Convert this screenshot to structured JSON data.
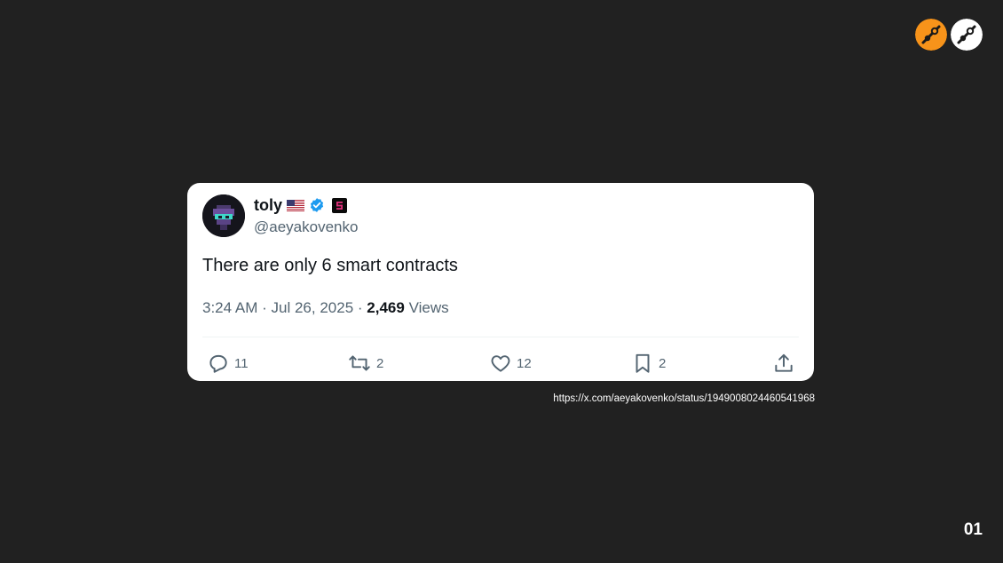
{
  "brand": {
    "accent_color": "#f7931a",
    "logos": [
      {
        "icon": "orange-slash-logo-icon",
        "color": "#f7931a"
      },
      {
        "icon": "white-slash-logo-icon",
        "color": "#ffffff"
      }
    ]
  },
  "tweet": {
    "display_name": "toly",
    "handle": "@aeyakovenko",
    "icons": [
      "us-flag-icon",
      "verified-icon",
      "solana-badge-icon"
    ],
    "text": "There are only 6 smart contracts",
    "time": "3:24 AM",
    "separator": "·",
    "date": "Jul 26, 2025",
    "views_count": "2,469",
    "views_label": "Views",
    "actions": {
      "replies": "11",
      "retweets": "2",
      "likes": "12",
      "bookmarks": "2"
    }
  },
  "tweet_url": "https://x.com/aeyakovenko/status/1949008024460541968",
  "page_number": "01"
}
